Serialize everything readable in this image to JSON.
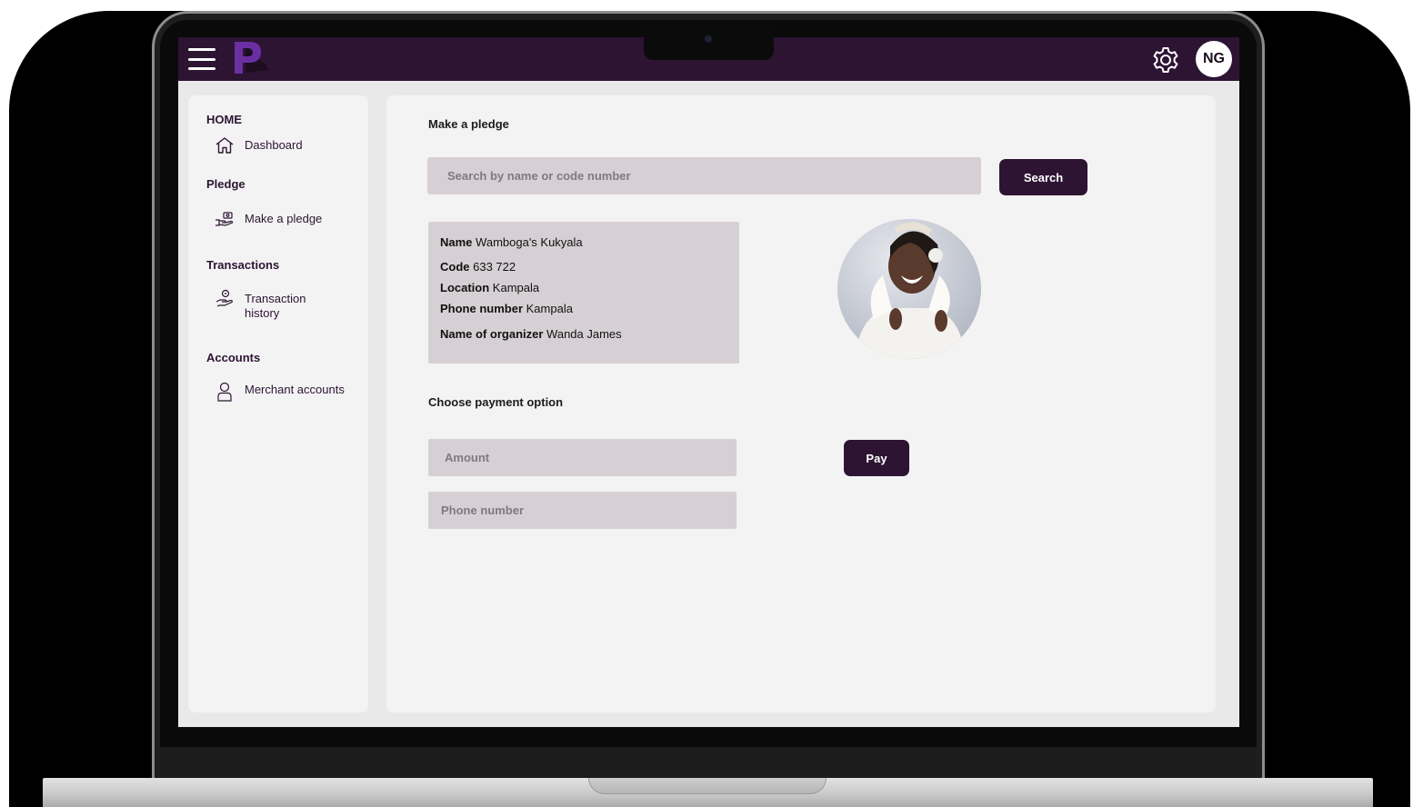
{
  "app": {
    "logo_letter": "P",
    "avatar_initials": "NG"
  },
  "sidebar": {
    "sections": [
      {
        "heading": "HOME",
        "items": [
          {
            "label": "Dashboard",
            "icon": "home-icon"
          }
        ]
      },
      {
        "heading": "Pledge",
        "items": [
          {
            "label": "Make a pledge",
            "icon": "pledge-hand-icon"
          }
        ]
      },
      {
        "heading": "Transactions",
        "items": [
          {
            "label": "Transaction history",
            "icon": "transaction-hand-icon"
          }
        ]
      },
      {
        "heading": "Accounts",
        "items": [
          {
            "label": "Merchant accounts",
            "icon": "user-icon"
          }
        ]
      }
    ]
  },
  "main": {
    "title": "Make a pledge",
    "search": {
      "placeholder": "Search by name or code number",
      "button_label": "Search"
    },
    "details": {
      "name_label": "Name",
      "name_value": "Wamboga's Kukyala",
      "code_label": "Code",
      "code_value": "633 722",
      "location_label": "Location",
      "location_value": "Kampala",
      "phone_label": "Phone number",
      "phone_value": "Kampala",
      "organizer_label": "Name of organizer",
      "organizer_value": "Wanda James"
    },
    "payment": {
      "title": "Choose payment option",
      "amount_placeholder": "Amount",
      "phone_placeholder": "Phone number",
      "pay_label": "Pay"
    }
  },
  "colors": {
    "brand_dark": "#2d1433",
    "card_gray": "#d6d0d4",
    "panel": "#f3f3f3",
    "logo_purple": "#6b2fa3"
  }
}
